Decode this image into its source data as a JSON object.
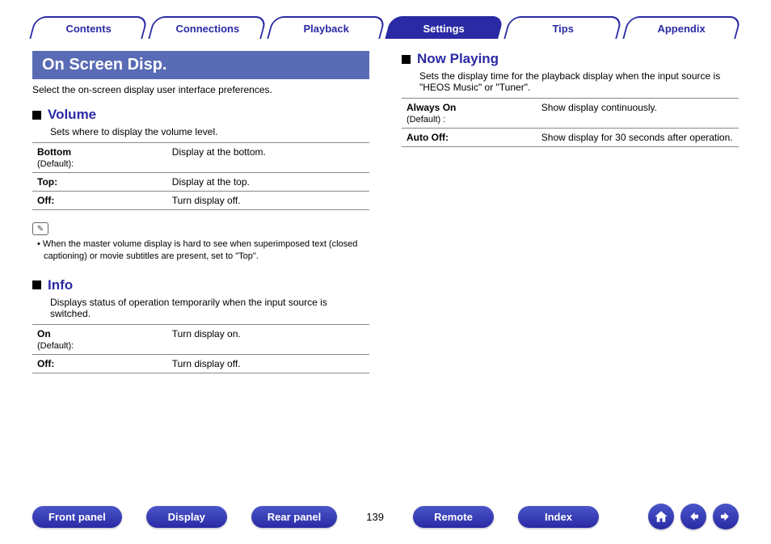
{
  "tabs": {
    "contents": "Contents",
    "connections": "Connections",
    "playback": "Playback",
    "settings": "Settings",
    "tips": "Tips",
    "appendix": "Appendix"
  },
  "banner": "On Screen Disp.",
  "intro": "Select the on-screen display user interface preferences.",
  "volume": {
    "title": "Volume",
    "desc": "Sets where to display the volume level.",
    "rows": [
      {
        "name": "Bottom",
        "def": "(Default):",
        "val": "Display at the bottom."
      },
      {
        "name": "Top:",
        "def": "",
        "val": "Display at the top."
      },
      {
        "name": "Off:",
        "def": "",
        "val": "Turn display off."
      }
    ],
    "note": "When the master volume display is hard to see when superimposed text (closed captioning) or movie subtitles are present, set to \"Top\"."
  },
  "info": {
    "title": "Info",
    "desc": "Displays status of operation temporarily when the input source is switched.",
    "rows": [
      {
        "name": "On",
        "def": "(Default):",
        "val": "Turn display on."
      },
      {
        "name": "Off:",
        "def": "",
        "val": "Turn display off."
      }
    ]
  },
  "nowplaying": {
    "title": "Now Playing",
    "desc": "Sets the display time for the playback display when the input source is \"HEOS Music\" or \"Tuner\".",
    "rows": [
      {
        "name": "Always On",
        "def": "(Default) :",
        "val": "Show display continuously."
      },
      {
        "name": "Auto Off:",
        "def": "",
        "val": "Show display for 30 seconds after operation."
      }
    ]
  },
  "footer": {
    "frontpanel": "Front panel",
    "display": "Display",
    "rearpanel": "Rear panel",
    "page": "139",
    "remote": "Remote",
    "index": "Index"
  }
}
